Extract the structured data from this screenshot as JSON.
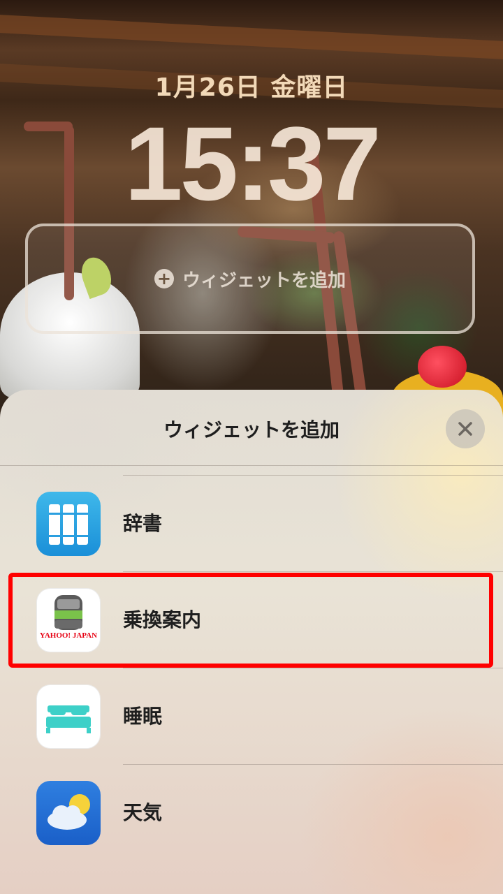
{
  "lockscreen": {
    "date": "1月26日 金曜日",
    "time": "15:37",
    "add_widget_label": "ウィジェットを追加"
  },
  "sheet": {
    "title": "ウィジェットを追加",
    "items": [
      {
        "label": "辞書",
        "icon": "dictionary-icon"
      },
      {
        "label": "乗換案内",
        "icon": "yahoo-transit-icon",
        "icon_text": "YAHOO! JAPAN"
      },
      {
        "label": "睡眠",
        "icon": "sleep-bed-icon"
      },
      {
        "label": "天気",
        "icon": "weather-icon"
      }
    ],
    "highlight_color": "#ff0000"
  }
}
